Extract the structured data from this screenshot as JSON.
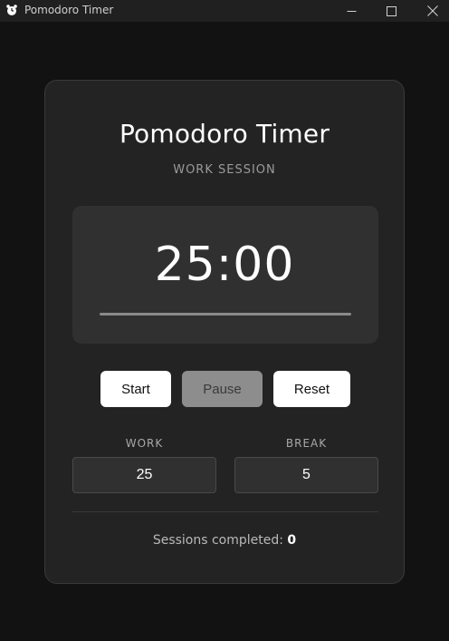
{
  "window": {
    "title": "Pomodoro Timer",
    "icon": "alarm-clock-icon"
  },
  "app": {
    "title": "Pomodoro Timer",
    "session_label": "WORK SESSION",
    "time": "25:00",
    "progress": 1.0
  },
  "controls": {
    "start_label": "Start",
    "pause_label": "Pause",
    "reset_label": "Reset"
  },
  "settings": {
    "work_label": "WORK",
    "work_value": "25",
    "break_label": "BREAK",
    "break_value": "5"
  },
  "stats": {
    "sessions_label": "Sessions completed:",
    "sessions_value": "0"
  }
}
